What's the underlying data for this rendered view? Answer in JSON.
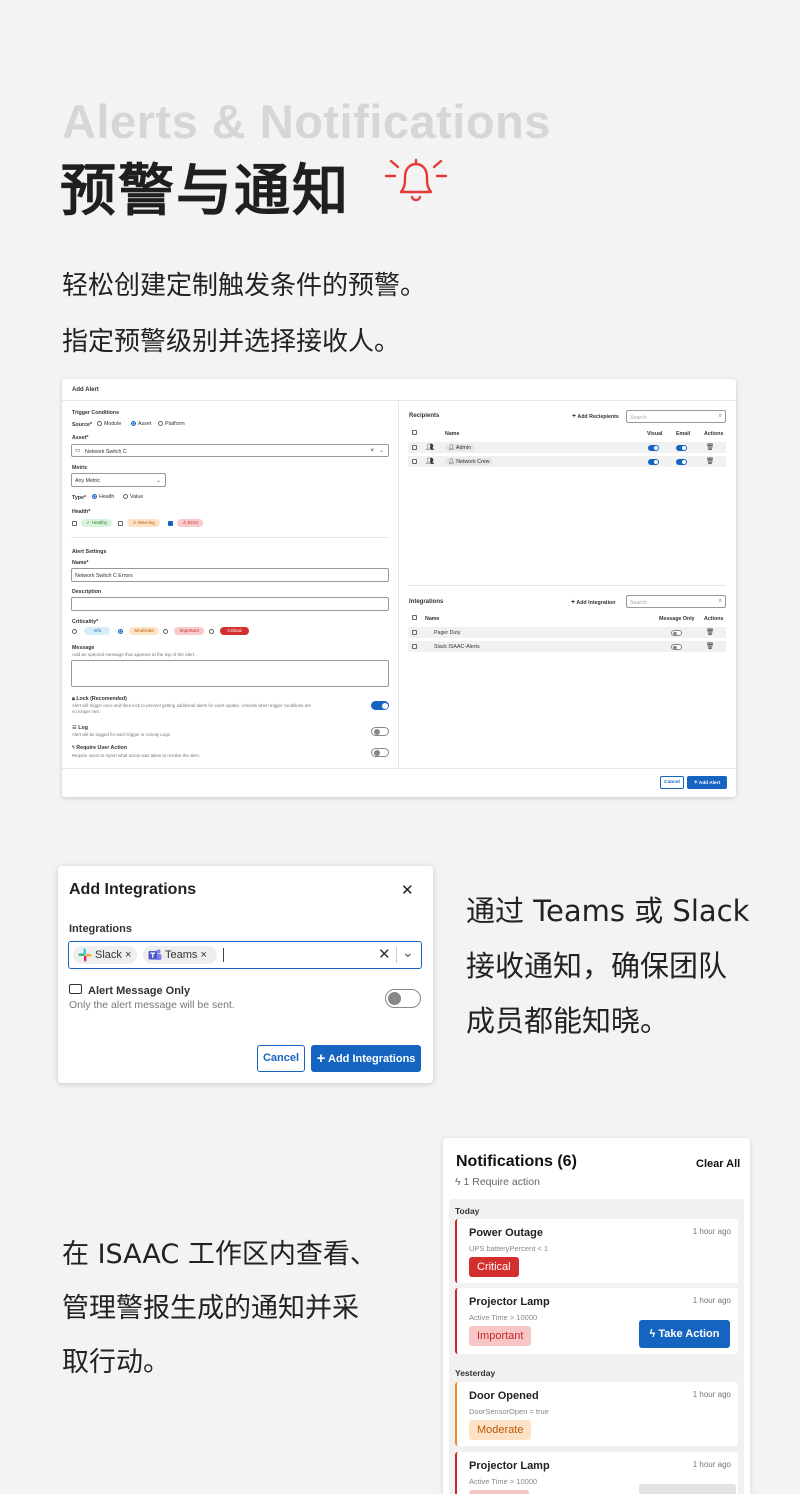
{
  "hero": {
    "title_en": "Alerts & Notifications",
    "title_cn": "预警与通知",
    "lead_line1": "轻松创建定制触发条件的预警。",
    "lead_line2": "指定预警级别并选择接收人。",
    "accent_color": "#e53935"
  },
  "add_alert": {
    "title": "Add Alert",
    "trigger_conditions": "Trigger Conditions",
    "source_label": "Source*",
    "source_options": [
      "Module",
      "Asset",
      "Platform"
    ],
    "source_selected": "Asset",
    "asset_label": "Asset*",
    "asset_value": "Network Switch C",
    "metric_label": "Metric",
    "metric_value": "Any Metric",
    "type_label": "Type*",
    "type_options": [
      "Health",
      "Value"
    ],
    "type_selected": "Health",
    "health_label": "Health*",
    "health_options": [
      {
        "label": "Healthy",
        "checked": false
      },
      {
        "label": "Warning",
        "checked": false
      },
      {
        "label": "Error",
        "checked": true
      }
    ],
    "alert_settings": "Alert Settings",
    "name_label": "Name*",
    "name_value": "Network Switch C Errors",
    "description_label": "Description",
    "criticality_label": "Criticality*",
    "criticality_options": [
      "Info",
      "Moderate",
      "Important",
      "Critical"
    ],
    "criticality_selected": "Moderate",
    "message_label": "Message",
    "message_hint": "Add an optional message that appears at the top of the alert.",
    "lock_title": "Lock (Recomended)",
    "lock_desc_1": "Alert will trigger once and then lock to prevent getting additional alerts for each update. Unlocks when trigger conditions are",
    "lock_desc_2": "no longer met.",
    "log_title": "Log",
    "log_desc": "Alert will be logged for each trigger in Activity Logs",
    "action_title": "Require User Action",
    "action_desc": "Require users to report what action was taken to resolve the alert.",
    "recipients_title": "Recipients",
    "add_recipients": "Add Reciepients",
    "search_placeholder": "Search",
    "recipients_headers": [
      "Name",
      "Visual",
      "Email",
      "Actions"
    ],
    "recipients": [
      {
        "name": "Admin",
        "visual": true,
        "email": true
      },
      {
        "name": "Network Crew",
        "visual": true,
        "email": true
      }
    ],
    "integrations_title": "Integrations",
    "add_integration": "Add Integration",
    "integrations_headers": [
      "Name",
      "Message Only",
      "Actions"
    ],
    "integrations": [
      {
        "name": "Pager Duty",
        "message_only": false
      },
      {
        "name": "Slack ISAAC-Alerts",
        "message_only": false
      }
    ],
    "cancel_label": "Cancel",
    "add_label": "Add Alert"
  },
  "add_integrations": {
    "title": "Add Integrations",
    "field_label": "Integrations",
    "chips": [
      "Slack",
      "Teams"
    ],
    "toggle_title": "Alert Message Only",
    "toggle_desc": "Only the alert message will be sent.",
    "cancel_label": "Cancel",
    "add_label": "Add Integrations",
    "brand_color": "#1565c0"
  },
  "side_text_1": [
    "通过 Teams 或 Slack",
    "接收通知，确保团队",
    "成员都能知晓。"
  ],
  "side_text_2": [
    "在 ISAAC 工作区内查看、",
    "管理警报生成的通知并采",
    "取行动。"
  ],
  "notifications": {
    "title": "Notifications (6)",
    "clear_all": "Clear All",
    "require_action": "1 Require action",
    "group_today": "Today",
    "group_yesterday": "Yesterday",
    "items": [
      {
        "title": "Power Outage",
        "time": "1 hour ago",
        "detail": "UPS batteryPercent < 1",
        "badge": "Critical"
      },
      {
        "title": "Projector Lamp",
        "time": "1 hour ago",
        "detail": "Active Time > 10000",
        "badge": "Important",
        "action": "Take Action"
      },
      {
        "title": "Door Opened",
        "time": "1 hour ago",
        "detail": "DoorSensorOpen = true",
        "badge": "Moderate"
      },
      {
        "title": "Projector Lamp",
        "time": "1 hour ago",
        "detail": "Active Time > 10000",
        "badge": ""
      }
    ]
  }
}
